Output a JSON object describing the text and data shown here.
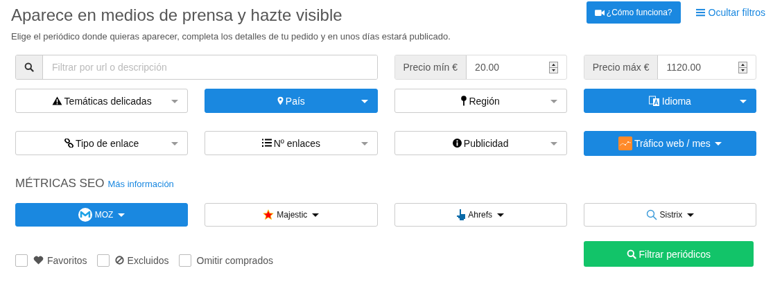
{
  "header": {
    "title": "Aparece en medios de prensa y hazte visible",
    "subtitle": "Elige el periódico donde quieras aparecer, completa los detalles de tu pedido y en unos días estará publicado.",
    "how_button": "¿Cómo funciona?",
    "hide_filters_link": "Ocultar filtros"
  },
  "search": {
    "placeholder": "Filtrar por url o descripción"
  },
  "prices": [
    {
      "label": "Precio mín €",
      "value": "20.00"
    },
    {
      "label": "Precio máx €",
      "value": "1120.00"
    }
  ],
  "filters": [
    {
      "label": "Temáticas delicadas",
      "kind": "select",
      "active": false
    },
    {
      "label": "País",
      "kind": "select",
      "active": true
    },
    {
      "label": "Región",
      "kind": "select",
      "active": false
    },
    {
      "label": "Idioma",
      "kind": "select",
      "active": true
    },
    {
      "label": "Tipo de enlace",
      "kind": "select",
      "active": false
    },
    {
      "label": "Nº enlaces",
      "kind": "select",
      "active": false
    },
    {
      "label": "Publicidad",
      "kind": "select",
      "active": false
    },
    {
      "label": "Tráfico web / mes",
      "kind": "menu",
      "active": true
    }
  ],
  "seo": {
    "title": "MÉTRICAS SEO",
    "link": "Más información",
    "metrics": [
      {
        "label": "MOZ",
        "active": true
      },
      {
        "label": "Majestic",
        "active": false
      },
      {
        "label": "Ahrefs",
        "active": false
      },
      {
        "label": "Sistrix",
        "active": false
      }
    ]
  },
  "options": [
    {
      "label": "Favoritos",
      "checked": false
    },
    {
      "label": "Excluidos",
      "checked": false
    },
    {
      "label": "Omitir comprados",
      "checked": false
    }
  ],
  "submit_button": "Filtrar periódicos"
}
